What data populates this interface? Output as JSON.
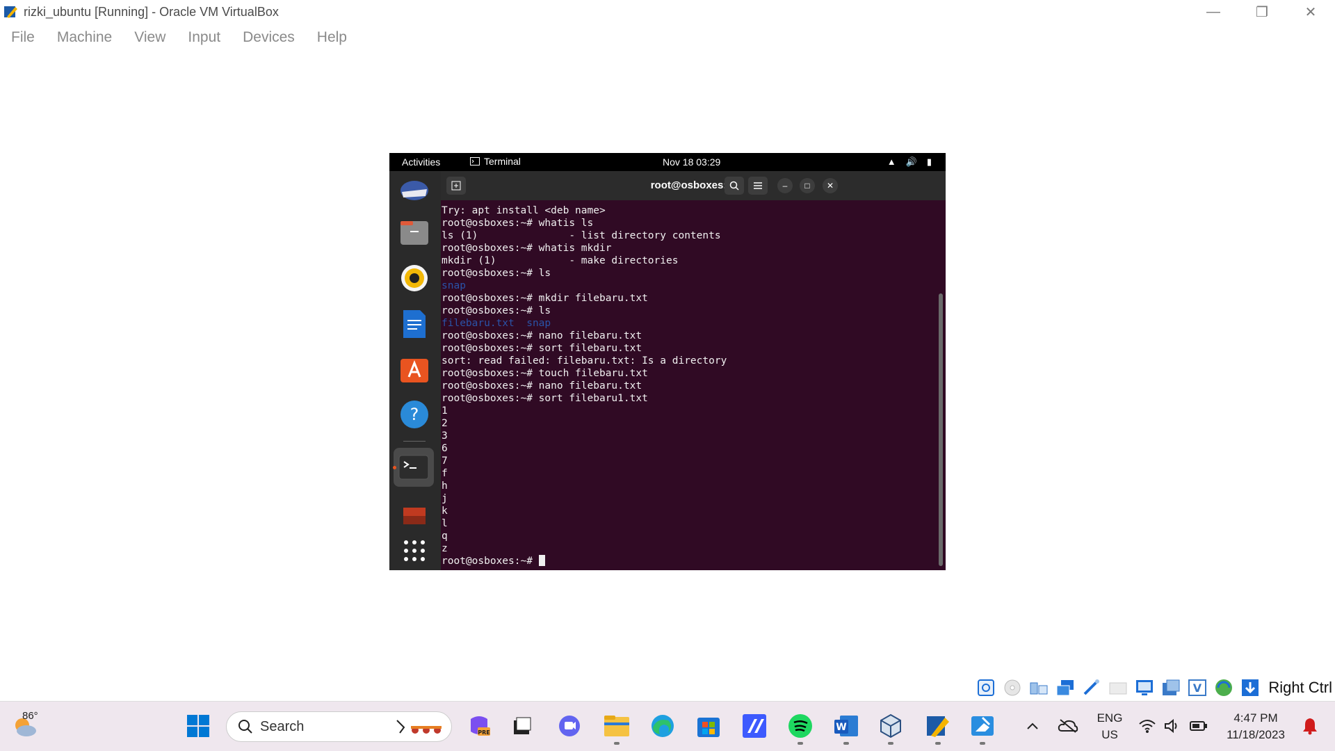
{
  "window": {
    "title": "rizki_ubuntu [Running] - Oracle VM VirtualBox",
    "menu": [
      "File",
      "Machine",
      "View",
      "Input",
      "Devices",
      "Help"
    ]
  },
  "guest": {
    "topbar": {
      "activities": "Activities",
      "app_name": "Terminal",
      "clock": "Nov 18  03:29"
    },
    "terminal": {
      "title": "root@osboxes: ~",
      "lines": [
        {
          "text": "Try: apt install <deb name>",
          "dir": false
        },
        {
          "text": "root@osboxes:~# whatis ls",
          "dir": false
        },
        {
          "text": "ls (1)               - list directory contents",
          "dir": false
        },
        {
          "text": "root@osboxes:~# whatis mkdir",
          "dir": false
        },
        {
          "text": "mkdir (1)            - make directories",
          "dir": false
        },
        {
          "text": "root@osboxes:~# ls",
          "dir": false
        },
        {
          "text": "snap",
          "dir": true
        },
        {
          "text": "root@osboxes:~# mkdir filebaru.txt",
          "dir": false
        },
        {
          "text": "root@osboxes:~# ls",
          "dir": false
        },
        {
          "text": "filebaru.txt  snap",
          "dir": true
        },
        {
          "text": "root@osboxes:~# nano filebaru.txt",
          "dir": false
        },
        {
          "text": "root@osboxes:~# sort filebaru.txt",
          "dir": false
        },
        {
          "text": "sort: read failed: filebaru.txt: Is a directory",
          "dir": false
        },
        {
          "text": "root@osboxes:~# touch filebaru.txt",
          "dir": false
        },
        {
          "text": "root@osboxes:~# nano filebaru.txt",
          "dir": false
        },
        {
          "text": "root@osboxes:~# sort filebaru1.txt",
          "dir": false
        },
        {
          "text": "1",
          "dir": false
        },
        {
          "text": "2",
          "dir": false
        },
        {
          "text": "3",
          "dir": false
        },
        {
          "text": "6",
          "dir": false
        },
        {
          "text": "7",
          "dir": false
        },
        {
          "text": "f",
          "dir": false
        },
        {
          "text": "h",
          "dir": false
        },
        {
          "text": "j",
          "dir": false
        },
        {
          "text": "k",
          "dir": false
        },
        {
          "text": "l",
          "dir": false
        },
        {
          "text": "q",
          "dir": false
        },
        {
          "text": "z",
          "dir": false
        }
      ],
      "prompt": "root@osboxes:~# "
    },
    "dock": [
      "thunderbird-icon",
      "files-icon",
      "rhythmbox-icon",
      "libreoffice-writer-icon",
      "app-center-icon",
      "help-icon",
      "terminal-icon",
      "trash-icon",
      "show-apps-icon"
    ]
  },
  "statusbar": {
    "host_key": "Right Ctrl"
  },
  "taskbar": {
    "weather_temp": "86°",
    "search_placeholder": "Search",
    "language": "ENG",
    "region": "US",
    "time": "4:47 PM",
    "date": "11/18/2023",
    "colors": {
      "accent_blue": "#0078d4",
      "ubuntu_orange": "#e95420",
      "terminal_bg": "#300a24"
    }
  }
}
